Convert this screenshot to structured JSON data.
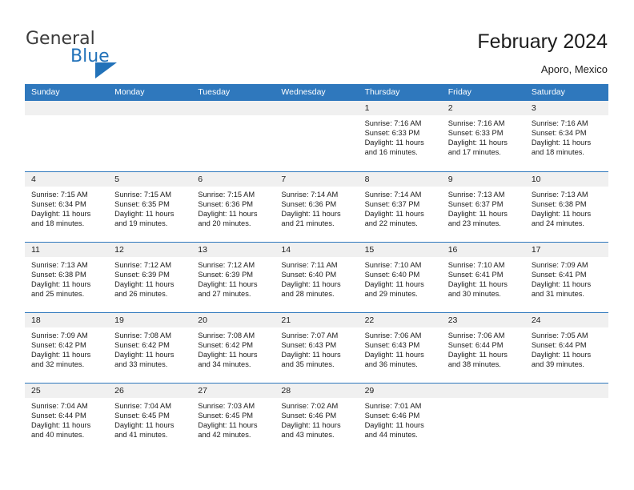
{
  "brand": {
    "name_part1": "General",
    "name_part2": "Blue"
  },
  "header": {
    "title": "February 2024",
    "subtitle": "Aporo, Mexico"
  },
  "calendar": {
    "weekday_headers": [
      "Sunday",
      "Monday",
      "Tuesday",
      "Wednesday",
      "Thursday",
      "Friday",
      "Saturday"
    ],
    "colors": {
      "header_bg": "#2f78bd",
      "header_text": "#ffffff",
      "daynum_band_bg": "#f0f0f0",
      "row_separator": "#2f78bd",
      "brand_blue": "#2272b9",
      "text": "#1c1c1c"
    },
    "weeks": [
      [
        {
          "day": "",
          "empty": true
        },
        {
          "day": "",
          "empty": true
        },
        {
          "day": "",
          "empty": true
        },
        {
          "day": "",
          "empty": true
        },
        {
          "day": "1",
          "sunrise": "Sunrise: 7:16 AM",
          "sunset": "Sunset: 6:33 PM",
          "daylight": "Daylight: 11 hours and 16 minutes."
        },
        {
          "day": "2",
          "sunrise": "Sunrise: 7:16 AM",
          "sunset": "Sunset: 6:33 PM",
          "daylight": "Daylight: 11 hours and 17 minutes."
        },
        {
          "day": "3",
          "sunrise": "Sunrise: 7:16 AM",
          "sunset": "Sunset: 6:34 PM",
          "daylight": "Daylight: 11 hours and 18 minutes."
        }
      ],
      [
        {
          "day": "4",
          "sunrise": "Sunrise: 7:15 AM",
          "sunset": "Sunset: 6:34 PM",
          "daylight": "Daylight: 11 hours and 18 minutes."
        },
        {
          "day": "5",
          "sunrise": "Sunrise: 7:15 AM",
          "sunset": "Sunset: 6:35 PM",
          "daylight": "Daylight: 11 hours and 19 minutes."
        },
        {
          "day": "6",
          "sunrise": "Sunrise: 7:15 AM",
          "sunset": "Sunset: 6:36 PM",
          "daylight": "Daylight: 11 hours and 20 minutes."
        },
        {
          "day": "7",
          "sunrise": "Sunrise: 7:14 AM",
          "sunset": "Sunset: 6:36 PM",
          "daylight": "Daylight: 11 hours and 21 minutes."
        },
        {
          "day": "8",
          "sunrise": "Sunrise: 7:14 AM",
          "sunset": "Sunset: 6:37 PM",
          "daylight": "Daylight: 11 hours and 22 minutes."
        },
        {
          "day": "9",
          "sunrise": "Sunrise: 7:13 AM",
          "sunset": "Sunset: 6:37 PM",
          "daylight": "Daylight: 11 hours and 23 minutes."
        },
        {
          "day": "10",
          "sunrise": "Sunrise: 7:13 AM",
          "sunset": "Sunset: 6:38 PM",
          "daylight": "Daylight: 11 hours and 24 minutes."
        }
      ],
      [
        {
          "day": "11",
          "sunrise": "Sunrise: 7:13 AM",
          "sunset": "Sunset: 6:38 PM",
          "daylight": "Daylight: 11 hours and 25 minutes."
        },
        {
          "day": "12",
          "sunrise": "Sunrise: 7:12 AM",
          "sunset": "Sunset: 6:39 PM",
          "daylight": "Daylight: 11 hours and 26 minutes."
        },
        {
          "day": "13",
          "sunrise": "Sunrise: 7:12 AM",
          "sunset": "Sunset: 6:39 PM",
          "daylight": "Daylight: 11 hours and 27 minutes."
        },
        {
          "day": "14",
          "sunrise": "Sunrise: 7:11 AM",
          "sunset": "Sunset: 6:40 PM",
          "daylight": "Daylight: 11 hours and 28 minutes."
        },
        {
          "day": "15",
          "sunrise": "Sunrise: 7:10 AM",
          "sunset": "Sunset: 6:40 PM",
          "daylight": "Daylight: 11 hours and 29 minutes."
        },
        {
          "day": "16",
          "sunrise": "Sunrise: 7:10 AM",
          "sunset": "Sunset: 6:41 PM",
          "daylight": "Daylight: 11 hours and 30 minutes."
        },
        {
          "day": "17",
          "sunrise": "Sunrise: 7:09 AM",
          "sunset": "Sunset: 6:41 PM",
          "daylight": "Daylight: 11 hours and 31 minutes."
        }
      ],
      [
        {
          "day": "18",
          "sunrise": "Sunrise: 7:09 AM",
          "sunset": "Sunset: 6:42 PM",
          "daylight": "Daylight: 11 hours and 32 minutes."
        },
        {
          "day": "19",
          "sunrise": "Sunrise: 7:08 AM",
          "sunset": "Sunset: 6:42 PM",
          "daylight": "Daylight: 11 hours and 33 minutes."
        },
        {
          "day": "20",
          "sunrise": "Sunrise: 7:08 AM",
          "sunset": "Sunset: 6:42 PM",
          "daylight": "Daylight: 11 hours and 34 minutes."
        },
        {
          "day": "21",
          "sunrise": "Sunrise: 7:07 AM",
          "sunset": "Sunset: 6:43 PM",
          "daylight": "Daylight: 11 hours and 35 minutes."
        },
        {
          "day": "22",
          "sunrise": "Sunrise: 7:06 AM",
          "sunset": "Sunset: 6:43 PM",
          "daylight": "Daylight: 11 hours and 36 minutes."
        },
        {
          "day": "23",
          "sunrise": "Sunrise: 7:06 AM",
          "sunset": "Sunset: 6:44 PM",
          "daylight": "Daylight: 11 hours and 38 minutes."
        },
        {
          "day": "24",
          "sunrise": "Sunrise: 7:05 AM",
          "sunset": "Sunset: 6:44 PM",
          "daylight": "Daylight: 11 hours and 39 minutes."
        }
      ],
      [
        {
          "day": "25",
          "sunrise": "Sunrise: 7:04 AM",
          "sunset": "Sunset: 6:44 PM",
          "daylight": "Daylight: 11 hours and 40 minutes."
        },
        {
          "day": "26",
          "sunrise": "Sunrise: 7:04 AM",
          "sunset": "Sunset: 6:45 PM",
          "daylight": "Daylight: 11 hours and 41 minutes."
        },
        {
          "day": "27",
          "sunrise": "Sunrise: 7:03 AM",
          "sunset": "Sunset: 6:45 PM",
          "daylight": "Daylight: 11 hours and 42 minutes."
        },
        {
          "day": "28",
          "sunrise": "Sunrise: 7:02 AM",
          "sunset": "Sunset: 6:46 PM",
          "daylight": "Daylight: 11 hours and 43 minutes."
        },
        {
          "day": "29",
          "sunrise": "Sunrise: 7:01 AM",
          "sunset": "Sunset: 6:46 PM",
          "daylight": "Daylight: 11 hours and 44 minutes."
        },
        {
          "day": "",
          "empty": true
        },
        {
          "day": "",
          "empty": true
        }
      ]
    ]
  }
}
